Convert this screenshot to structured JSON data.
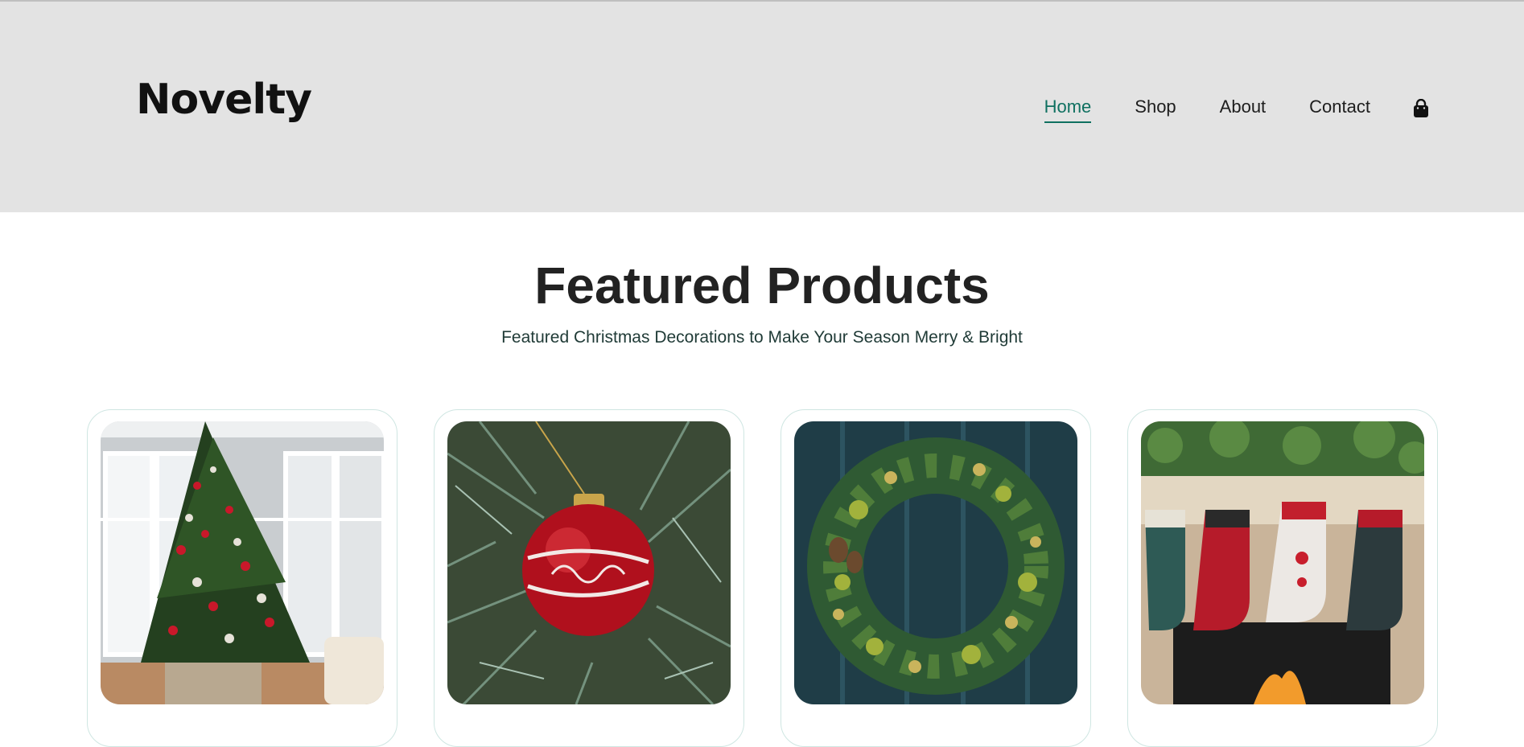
{
  "brand": {
    "logo": "Novelty",
    "accent": "#0f7060"
  },
  "nav": {
    "items": [
      {
        "label": "Home",
        "active": true
      },
      {
        "label": "Shop",
        "active": false
      },
      {
        "label": "About",
        "active": false
      },
      {
        "label": "Contact",
        "active": false
      }
    ],
    "cart_icon": "shopping-bag-icon"
  },
  "featured": {
    "title": "Featured Products",
    "subtitle": "Featured Christmas Decorations to Make Your Season Merry & Bright"
  },
  "products": [
    {
      "image": "christmas-tree-living-room"
    },
    {
      "image": "red-ornament-on-branch"
    },
    {
      "image": "wreath-on-blue-door"
    },
    {
      "image": "stockings-on-fireplace-noel"
    }
  ]
}
